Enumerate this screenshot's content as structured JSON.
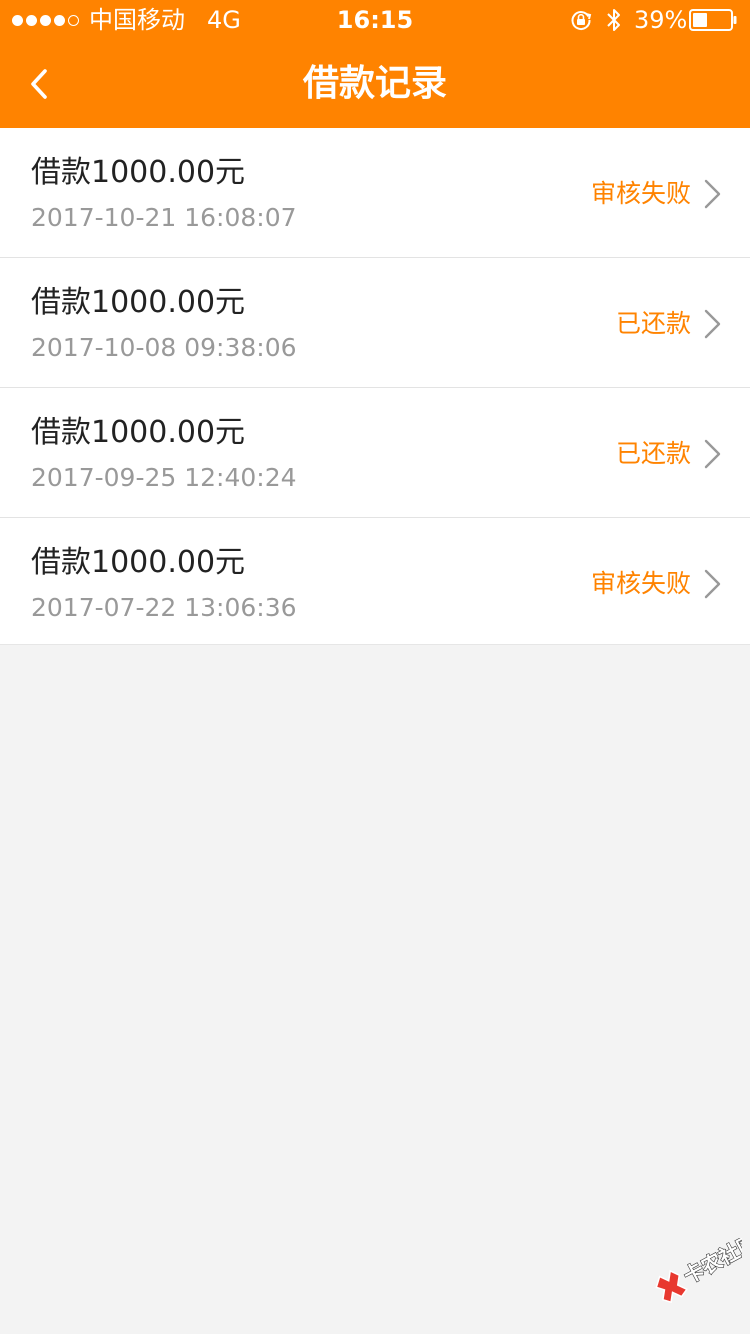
{
  "status_bar": {
    "carrier": "中国移动",
    "network": "4G",
    "time": "16:15",
    "battery_percent": "39%",
    "battery_level": 0.39,
    "signal_bars_filled": 4,
    "signal_bars_total": 5
  },
  "nav": {
    "title": "借款记录",
    "back_icon": "chevron-left-icon"
  },
  "records": [
    {
      "amount": "借款1000.00元",
      "datetime": "2017-10-21 16:08:07",
      "status": "审核失败"
    },
    {
      "amount": "借款1000.00元",
      "datetime": "2017-10-08 09:38:06",
      "status": "已还款"
    },
    {
      "amount": "借款1000.00元",
      "datetime": "2017-09-25 12:40:24",
      "status": "已还款"
    },
    {
      "amount": "借款1000.00元",
      "datetime": "2017-07-22 13:06:36",
      "status": "审核失败"
    }
  ],
  "watermark": {
    "text": "卡农社区"
  },
  "colors": {
    "accent": "#ff8300",
    "background": "#f3f3f3",
    "primary_text": "#222222",
    "secondary_text": "#999999"
  }
}
